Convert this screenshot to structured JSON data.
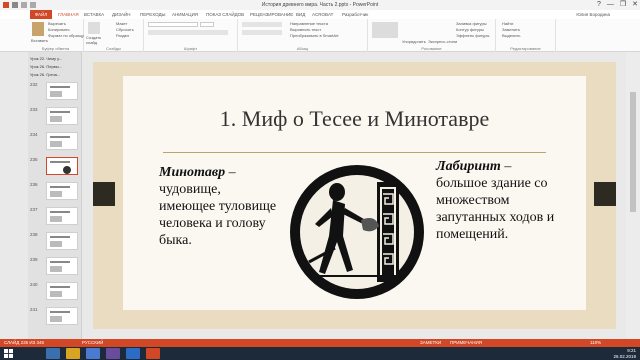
{
  "window": {
    "title": "История древнего мира. Часть 2.pptx - PowerPoint",
    "controls": [
      "?",
      "—",
      "❐",
      "✕"
    ]
  },
  "tabs": {
    "file": "ФАЙЛ",
    "items": [
      "ГЛАВНАЯ",
      "ВСТАВКА",
      "ДИЗАЙН",
      "ПЕРЕХОДЫ",
      "АНИМАЦИЯ",
      "ПОКАЗ СЛАЙДОВ",
      "РЕЦЕНЗИРОВАНИЕ",
      "ВИД",
      "ACROBAT",
      "Разработчик"
    ],
    "user": "Юлия Бородина"
  },
  "ribbon": {
    "clipboard": {
      "label": "Буфер обмена",
      "paste": "Вставить",
      "cut": "Вырезать",
      "copy": "Копировать",
      "format": "Формат по образцу"
    },
    "slides": {
      "label": "Слайды",
      "new": "Создать слайд",
      "layout": "Макет",
      "reset": "Сбросить",
      "section": "Раздел"
    },
    "font": {
      "label": "Шрифт"
    },
    "paragraph": {
      "label": "Абзац",
      "direction": "Направление текста",
      "align": "Выровнять текст",
      "smartart": "Преобразовать в SmartArt"
    },
    "drawing": {
      "label": "Рисование",
      "arrange": "Упорядочить",
      "styles": "Экспресс-стили",
      "fill": "Заливка фигуры",
      "outline": "Контур фигуры",
      "effects": "Эффекты фигуры"
    },
    "editing": {
      "label": "Редактирование",
      "find": "Найти",
      "replace": "Заменить",
      "select": "Выделить"
    }
  },
  "outline": [
    "Урок 22. Чему у...",
    "Урок 26. Первы...",
    "Урок 26. Греча..."
  ],
  "thumbnails": [
    {
      "num": "232"
    },
    {
      "num": "233"
    },
    {
      "num": "234"
    },
    {
      "num": "235"
    },
    {
      "num": "236"
    },
    {
      "num": "237"
    },
    {
      "num": "238"
    },
    {
      "num": "239"
    },
    {
      "num": "240"
    },
    {
      "num": "241"
    }
  ],
  "slide": {
    "title": "1. Миф о Тесее и Минотавре",
    "left": {
      "term": "Минотавр",
      "rest": " – чудовище, имеющее туловище человека и голову быка."
    },
    "right": {
      "term": "Лабиринт",
      "rest": " – большое здание со множеством запутанных ходов и помещений."
    }
  },
  "status": {
    "slide": "СЛАЙД 235 ИЗ 346",
    "lang": "РУССКИЙ",
    "notes": "ЗАМЕТКИ",
    "comments": "ПРИМЕЧАНИЯ",
    "zoom": "110%"
  },
  "taskbar": {
    "time": "9:21",
    "date": "26.02.2019"
  },
  "colors": {
    "accent": "#d24726",
    "slide_bg": "#e9dcc1",
    "rule": "#b9a46d"
  }
}
